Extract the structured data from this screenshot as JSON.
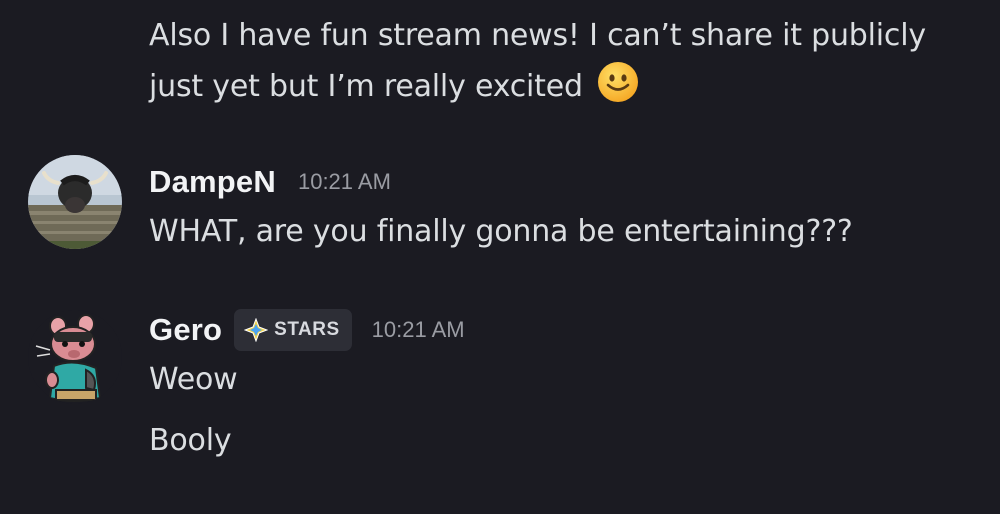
{
  "messages": [
    {
      "text_line1": "Also I have fun stream news! I can’t share it publicly",
      "text_line2": "just yet but I’m really excited",
      "emoji": "slightly-smiling-face-icon"
    }
  ],
  "dampen": {
    "username": "DampeN",
    "timestamp": "10:21 AM",
    "text": "WHAT, are you finally gonna be entertaining???",
    "avatar": "highland-cow-avatar"
  },
  "gero": {
    "username": "Gero",
    "tag": "STARS",
    "timestamp": "10:21 AM",
    "text1": "Weow",
    "text2": "Booly",
    "avatar": "rat-character-avatar"
  },
  "colors": {
    "background": "#1b1b22",
    "text": "#dbdee1",
    "username": "#f2f3f5",
    "timestamp": "#9a9ca3",
    "tag_bg": "#2d2e36"
  }
}
